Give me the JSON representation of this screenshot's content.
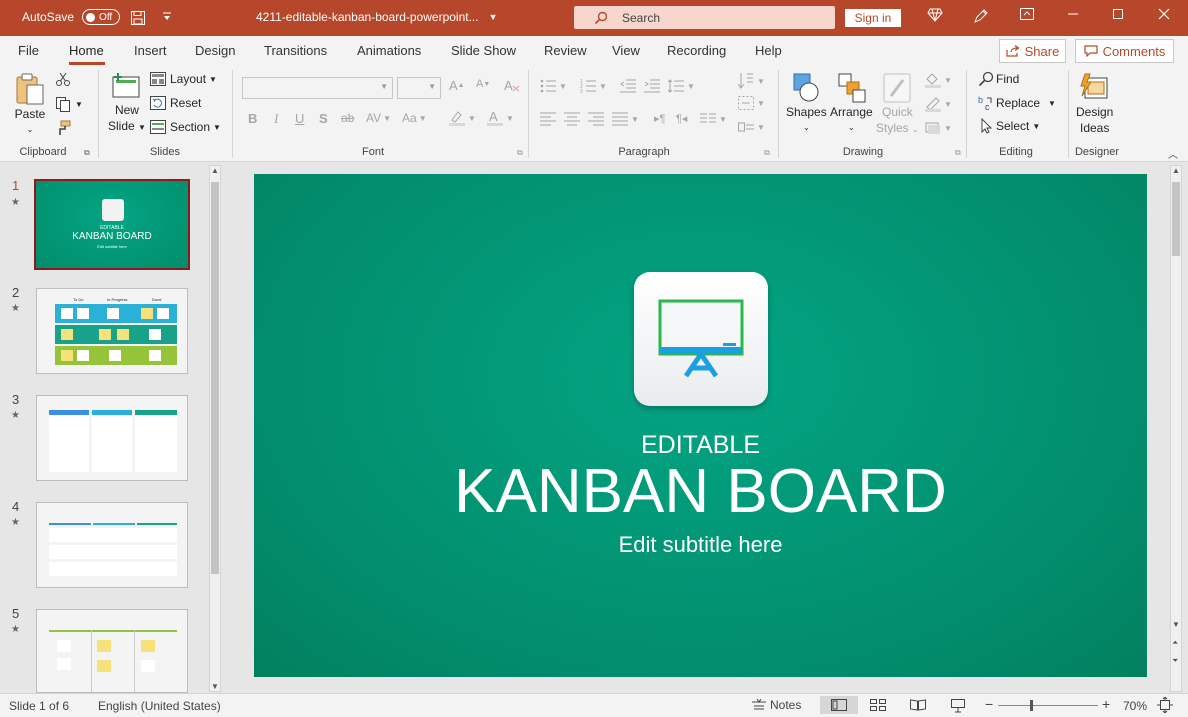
{
  "titlebar": {
    "autosave_label": "AutoSave",
    "autosave_state": "Off",
    "doc_title": "4211-editable-kanban-board-powerpoint...",
    "search_placeholder": "Search",
    "signin_label": "Sign in"
  },
  "menu": {
    "tabs": [
      "File",
      "Home",
      "Insert",
      "Design",
      "Transitions",
      "Animations",
      "Slide Show",
      "Review",
      "View",
      "Recording",
      "Help"
    ],
    "share_label": "Share",
    "comments_label": "Comments"
  },
  "ribbon": {
    "clipboard": {
      "paste": "Paste",
      "group": "Clipboard"
    },
    "slides": {
      "new_slide_1": "New",
      "new_slide_2": "Slide",
      "layout": "Layout",
      "reset": "Reset",
      "section": "Section",
      "group": "Slides"
    },
    "font": {
      "group": "Font"
    },
    "paragraph": {
      "group": "Paragraph"
    },
    "drawing": {
      "shapes": "Shapes",
      "arrange": "Arrange",
      "quick_1": "Quick",
      "quick_2": "Styles",
      "group": "Drawing"
    },
    "editing": {
      "find": "Find",
      "replace": "Replace",
      "select": "Select",
      "group": "Editing"
    },
    "designer": {
      "ideas_1": "Design",
      "ideas_2": "Ideas",
      "group": "Designer"
    }
  },
  "thumbnails": [
    {
      "num": "1",
      "star": "★"
    },
    {
      "num": "2",
      "star": "★"
    },
    {
      "num": "3",
      "star": "★"
    },
    {
      "num": "4",
      "star": "★"
    },
    {
      "num": "5",
      "star": "★"
    }
  ],
  "slide": {
    "kicker": "EDITABLE",
    "title": "KANBAN BOARD",
    "subtitle": "Edit subtitle here",
    "background_color": "#028d6c"
  },
  "thumb_text": {
    "t1_kicker": "EDITABLE",
    "t1_title": "KANBAN BOARD",
    "t1_sub": "Edit subtitle here",
    "cols": [
      "To Do",
      "In Progress",
      "Done"
    ]
  },
  "status": {
    "slide_info": "Slide 1 of 6",
    "language": "English (United States)",
    "notes": "Notes",
    "zoom": "70%"
  },
  "colors": {
    "accent": "#b7472a",
    "slide_green": "#03a584"
  }
}
